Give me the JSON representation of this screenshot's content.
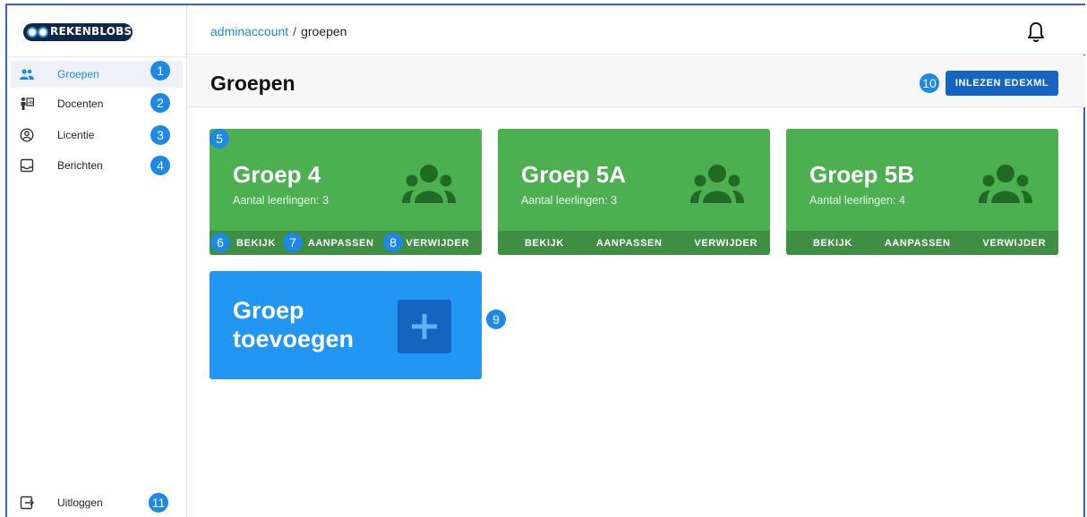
{
  "logo": {
    "text": "REKENBLOBS"
  },
  "breadcrumb": {
    "link": "adminaccount",
    "separator": "/",
    "current": "groepen"
  },
  "sidebar": {
    "items": [
      {
        "label": "Groepen",
        "icon": "people-icon",
        "badge": "1"
      },
      {
        "label": "Docenten",
        "icon": "teacher-icon",
        "badge": "2"
      },
      {
        "label": "Licentie",
        "icon": "account-circle-icon",
        "badge": "3"
      },
      {
        "label": "Berichten",
        "icon": "inbox-icon",
        "badge": "4"
      }
    ],
    "logout": {
      "label": "Uitloggen",
      "icon": "logout-icon",
      "badge": "11"
    }
  },
  "header": {
    "title": "Groepen",
    "import_label": "INLEZEN EDEXML",
    "import_badge": "10"
  },
  "groups": [
    {
      "name": "Groep 4",
      "count_text": "Aantal leerlingen: 3",
      "icon": "group-icon"
    },
    {
      "name": "Groep 5A",
      "count_text": "Aantal leerlingen: 3",
      "icon": "group-icon"
    },
    {
      "name": "Groep 5B",
      "count_text": "Aantal leerlingen: 4",
      "icon": "group-icon"
    }
  ],
  "card_actions": {
    "view": "BEKIJK",
    "edit": "AANPASSEN",
    "delete": "VERWIJDER"
  },
  "card_badges": {
    "card": "5",
    "view": "6",
    "edit": "7",
    "delete": "8"
  },
  "add_group": {
    "label": "Groep toevoegen",
    "badge": "9",
    "icon": "plus-icon"
  },
  "colors": {
    "accent": "#1e88e5",
    "card_green": "#4caf50",
    "card_green_dark": "#3e8f42",
    "add_blue": "#2196f3",
    "button_blue": "#1565c0"
  }
}
